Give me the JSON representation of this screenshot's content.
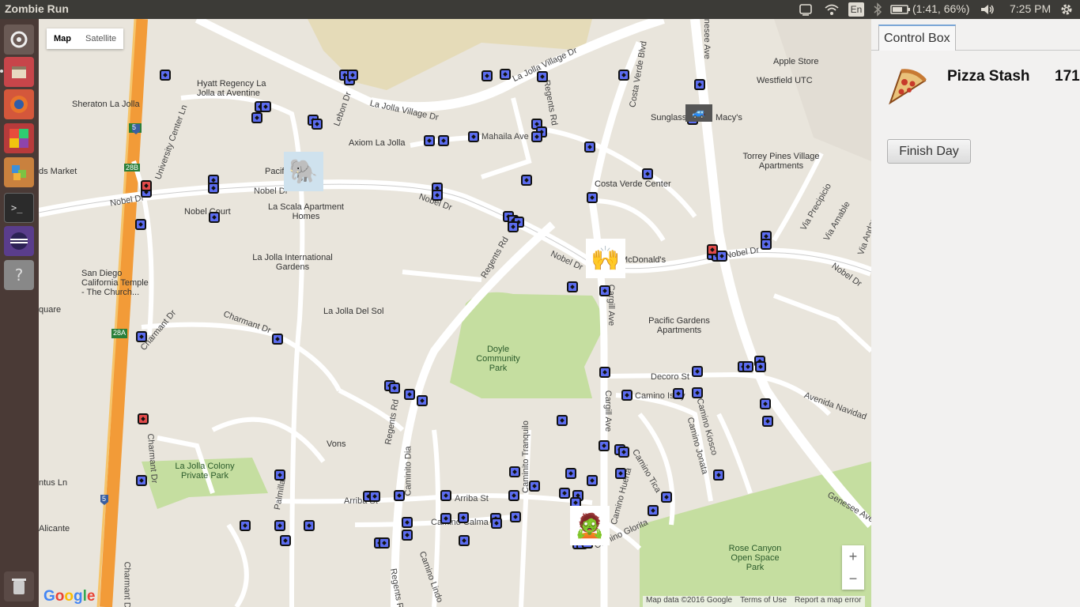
{
  "window": {
    "title": "Zombie Run"
  },
  "tray": {
    "keyboard": "En",
    "battery": "(1:41, 66%)",
    "clock": "7:25 PM"
  },
  "launcher": {
    "items": [
      {
        "name": "dash-icon"
      },
      {
        "name": "files-icon"
      },
      {
        "name": "firefox-icon"
      },
      {
        "name": "app-icon"
      },
      {
        "name": "software-center-icon"
      },
      {
        "name": "terminal-icon"
      },
      {
        "name": "eclipse-icon"
      },
      {
        "name": "unknown-app-icon"
      },
      {
        "name": "trash-icon"
      }
    ]
  },
  "map": {
    "type_buttons": [
      "Map",
      "Satellite"
    ],
    "active_type": "Map",
    "labels": {
      "l1": "La Jolla Village Dr",
      "l2": "La Jolla Village Dr",
      "l3": "Hyatt Regency La Jolla at Aventine",
      "l4": "Sheraton La Jolla",
      "l5": "Lebon Dr",
      "l6": "Axiom La Jolla",
      "l7": "Mahaila Ave",
      "l8": "Regents Rd",
      "l9": "Costa Verde Blvd",
      "l10": "Genesee Ave",
      "l11": "Apple Store",
      "l12": "Westfield UTC",
      "l13": "Sunglass Hut",
      "l14": "Macy's",
      "l15": "University Center Ln",
      "l16": "ds Market",
      "l17": "Pacific La Jolla",
      "l18": "Costa Verde Center",
      "l19": "Torrey Pines Village Apartments",
      "l20": "Nobel Dr",
      "l21": "Nobel Dr",
      "l22": "Nobel Court",
      "l23": "La Scala Apartment Homes",
      "l24": "Nobel Dr",
      "l25": "Nobel Dr",
      "l26": "Nobel Dr",
      "l27": "Via Precipicio",
      "l28": "Via Amable",
      "l29": "Via Andar",
      "l30": "San Diego California Temple - The Church...",
      "l31": "La Jolla International Gardens",
      "l32": "Regents Rd",
      "l33": "McDonald's",
      "l34": "quare",
      "l35": "La Jolla Del Sol",
      "l36": "Charmant Dr",
      "l37": "Charmant Dr",
      "l38": "Pacific Gardens Apartments",
      "l39": "Doyle Community Park",
      "l40": "Cargill Ave",
      "l41": "Decoro St",
      "l42": "Camino Islay",
      "l43": "Avenida Navidad",
      "l44": "Regents Rd",
      "l45": "Caminito Dia",
      "l46": "Vons",
      "l47": "Cargill Ave",
      "l48": "Camino Kiosco",
      "l49": "Camino Jonata",
      "l50": "Caminito Tranquilo",
      "l51": "Camino Tica",
      "l52": "Charmant Dr",
      "l53": "La Jolla Colony Private Park",
      "l54": "Palmilla",
      "l55": "Arriba St",
      "l56": "Arriba St",
      "l57": "Camino Huerta",
      "l58": "Genesee Ave",
      "l59": "Alicante",
      "l60": "Camino Calma",
      "l61": "Camino Glorita",
      "l62": "Rose Canyon Open Space Park",
      "l63": "Camino Lindo",
      "l64": "Regents Rd",
      "l65": "Charmant Dr",
      "l66": "ntus Ln"
    },
    "highway_signs": [
      "5",
      "28B",
      "28A",
      "5"
    ],
    "zoom_in": "+",
    "zoom_out": "−",
    "google_logo": "Google",
    "footer": [
      "Map data ©2016 Google",
      "Terms of Use",
      "Report a map error"
    ]
  },
  "control_box": {
    "tab": "Control Box",
    "stash_label": "Pizza Stash",
    "stash_value": "171",
    "finish_button": "Finish Day"
  }
}
